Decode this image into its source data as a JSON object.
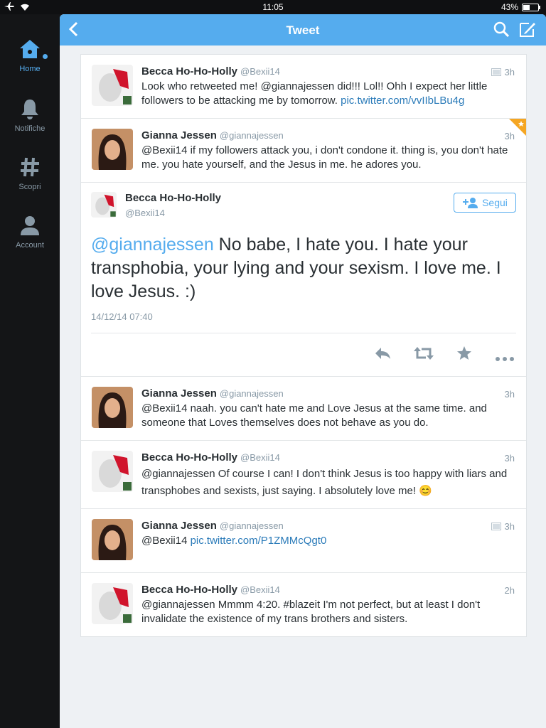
{
  "status_bar": {
    "time": "11:05",
    "battery": "43%",
    "battery_level": 0.43
  },
  "sidebar": {
    "items": [
      {
        "label": "Home",
        "icon": "home-icon",
        "active": true
      },
      {
        "label": "Notifiche",
        "icon": "bell-icon"
      },
      {
        "label": "Scopri",
        "icon": "hashtag-icon"
      },
      {
        "label": "Account",
        "icon": "person-icon"
      }
    ]
  },
  "navbar": {
    "title": "Tweet"
  },
  "tweets_before": [
    {
      "name": "Becca Ho-Ho-Holly",
      "handle": "@Bexii14",
      "time": "3h",
      "has_media_icon": true,
      "text": "Look who retweeted me! @giannajessen did!!! Lol!! Ohh I expect her little followers to be attacking me by tomorrow. ",
      "link": "pic.twitter.com/vvIIbLBu4g"
    },
    {
      "name": "Gianna Jessen",
      "handle": "@giannajessen",
      "time": "3h",
      "favorited": true,
      "text": "@Bexii14 if my followers attack you, i don't condone it. thing is, you don't hate me. you hate yourself, and the Jesus in me. he adores you."
    }
  ],
  "focus_tweet": {
    "name": "Becca Ho-Ho-Holly",
    "handle": "@Bexii14",
    "follow_label": "Segui",
    "mention": "@giannajessen",
    "text": " No babe, I hate you. I hate your transphobia, your lying and your sexism. I love me. I love Jesus. :)",
    "date": "14/12/14 07:40",
    "actions": [
      "reply-icon",
      "retweet-icon",
      "favorite-icon",
      "more-icon"
    ]
  },
  "tweets_after": [
    {
      "name": "Gianna Jessen",
      "handle": "@giannajessen",
      "time": "3h",
      "text": "@Bexii14 naah. you can't hate me and Love Jesus at the same time. and someone that Loves themselves does not behave as you do."
    },
    {
      "name": "Becca Ho-Ho-Holly",
      "handle": "@Bexii14",
      "time": "3h",
      "text": "@giannajessen Of course I can! I don't think Jesus is too happy with liars and transphobes and sexists, just saying. I absolutely love me! 😊"
    },
    {
      "name": "Gianna Jessen",
      "handle": "@giannajessen",
      "time": "3h",
      "has_media_icon": true,
      "text": "@Bexii14 ",
      "link": "pic.twitter.com/P1ZMMcQgt0"
    },
    {
      "name": "Becca Ho-Ho-Holly",
      "handle": "@Bexii14",
      "time": "2h",
      "text": "@giannajessen Mmmm 4:20. #blazeit I'm not perfect, but at least I don't invalidate the existence of my trans brothers and sisters."
    }
  ],
  "colors": {
    "accent": "#55acee",
    "link": "#2b7bb9",
    "fav": "#f5a623"
  }
}
